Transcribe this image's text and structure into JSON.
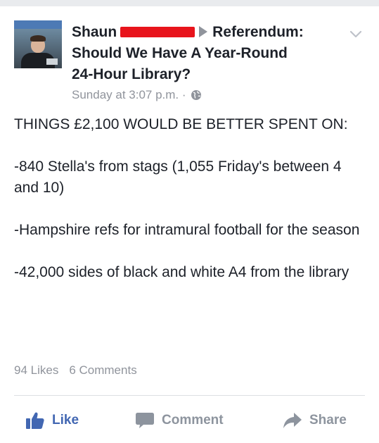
{
  "post": {
    "author": "Shaun",
    "target": "Referendum:",
    "title_line_1": "Should We Have A Year-Round",
    "title_line_2": "24-Hour Library?",
    "timestamp": "Sunday at 3:07 p.m.",
    "separator": "·",
    "privacy_icon": "globe-icon",
    "menu_icon": "chevron-down-icon",
    "avatar_banner_text": "",
    "body_paragraphs": [
      "THINGS £2,100 WOULD BE BETTER SPENT ON:",
      "-840 Stella's from stags (1,055 Friday's between 4 and 10)",
      "-Hampshire refs for intramural football for the season",
      "-42,000 sides of black and white A4 from the library"
    ]
  },
  "stats": {
    "likes": "94 Likes",
    "comments": "6 Comments"
  },
  "actions": {
    "like_label": "Like",
    "comment_label": "Comment",
    "share_label": "Share",
    "like_icon": "thumbs-up-icon",
    "comment_icon": "speech-bubble-icon",
    "share_icon": "share-arrow-icon"
  },
  "colors": {
    "text": "#1d2129",
    "muted": "#90949c",
    "like_blue": "#4267b2",
    "redaction": "#e8141c",
    "top_bar": "#e9ebee"
  }
}
